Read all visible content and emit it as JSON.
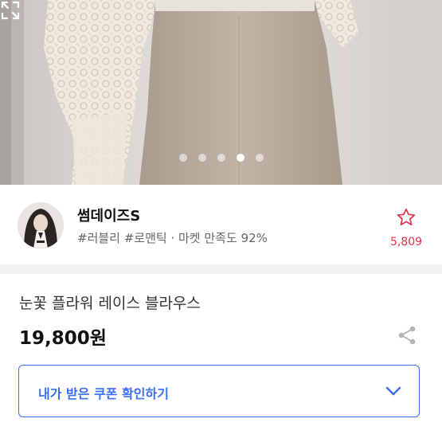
{
  "hero": {
    "slide_count": 5,
    "active_slide": 4
  },
  "seller": {
    "name": "썸데이즈S",
    "tags": "#러블리 #로맨틱 · 마켓 만족도 92%",
    "favorite_count": "5,809"
  },
  "product": {
    "title": "눈꽃 플라워 레이스 블라우스",
    "price": "19,800원"
  },
  "coupon": {
    "label": "내가 받은 쿠폰 확인하기"
  },
  "colors": {
    "accent_blue": "#3d6ef7",
    "favorite_red": "#e8334a"
  },
  "icons": {
    "expand": "expand-icon",
    "favorite": "star-outline-icon",
    "share": "share-icon",
    "chevron": "chevron-down-icon"
  }
}
